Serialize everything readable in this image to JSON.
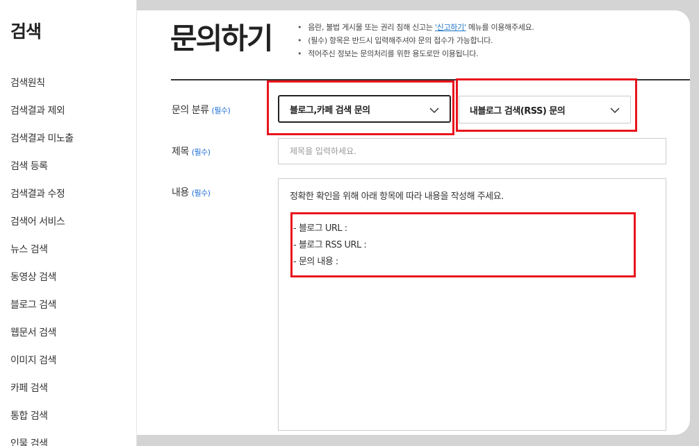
{
  "sidebar": {
    "title": "검색",
    "items": [
      {
        "label": "검색원칙"
      },
      {
        "label": "검색결과 제외"
      },
      {
        "label": "검색결과 미노출"
      },
      {
        "label": "검색 등록"
      },
      {
        "label": "검색결과 수정"
      },
      {
        "label": "검색어 서비스"
      },
      {
        "label": "뉴스 검색"
      },
      {
        "label": "동영상 검색"
      },
      {
        "label": "블로그 검색"
      },
      {
        "label": "웹문서 검색"
      },
      {
        "label": "이미지 검색"
      },
      {
        "label": "카페 검색"
      },
      {
        "label": "통합 검색"
      },
      {
        "label": "인물 검색"
      }
    ]
  },
  "page": {
    "title": "문의하기",
    "notes": {
      "line1_before": "음란, 불법 게시물 또는 권리 침해 신고는 ",
      "line1_link": "'신고하기'",
      "line1_after": " 메뉴를 이용해주세요.",
      "line2": "(필수) 항목은 반드시 입력해주셔야 문의 접수가 가능합니다.",
      "line3": "적어주신 정보는 문의처리를 위한 용도로만 이용됩니다."
    }
  },
  "form": {
    "required_tag": "(필수)",
    "category": {
      "label": "문의 분류",
      "select1_value": "블로그,카페 검색 문의",
      "select2_value": "내블로그 검색(RSS) 문의"
    },
    "subject": {
      "label": "제목",
      "placeholder": "제목을 입력하세요."
    },
    "content": {
      "label": "내용",
      "guide": "정확한 확인을 위해 아래 항목에 따라 내용을 작성해 주세요.",
      "lines": [
        "- 블로그 URL :",
        "- 블로그 RSS URL :",
        "- 문의 내용 :"
      ]
    }
  },
  "colors": {
    "highlight": "#e8141c",
    "required": "#1a6dd4",
    "link": "#1a73c8",
    "backdrop": "#d4d4d4"
  }
}
